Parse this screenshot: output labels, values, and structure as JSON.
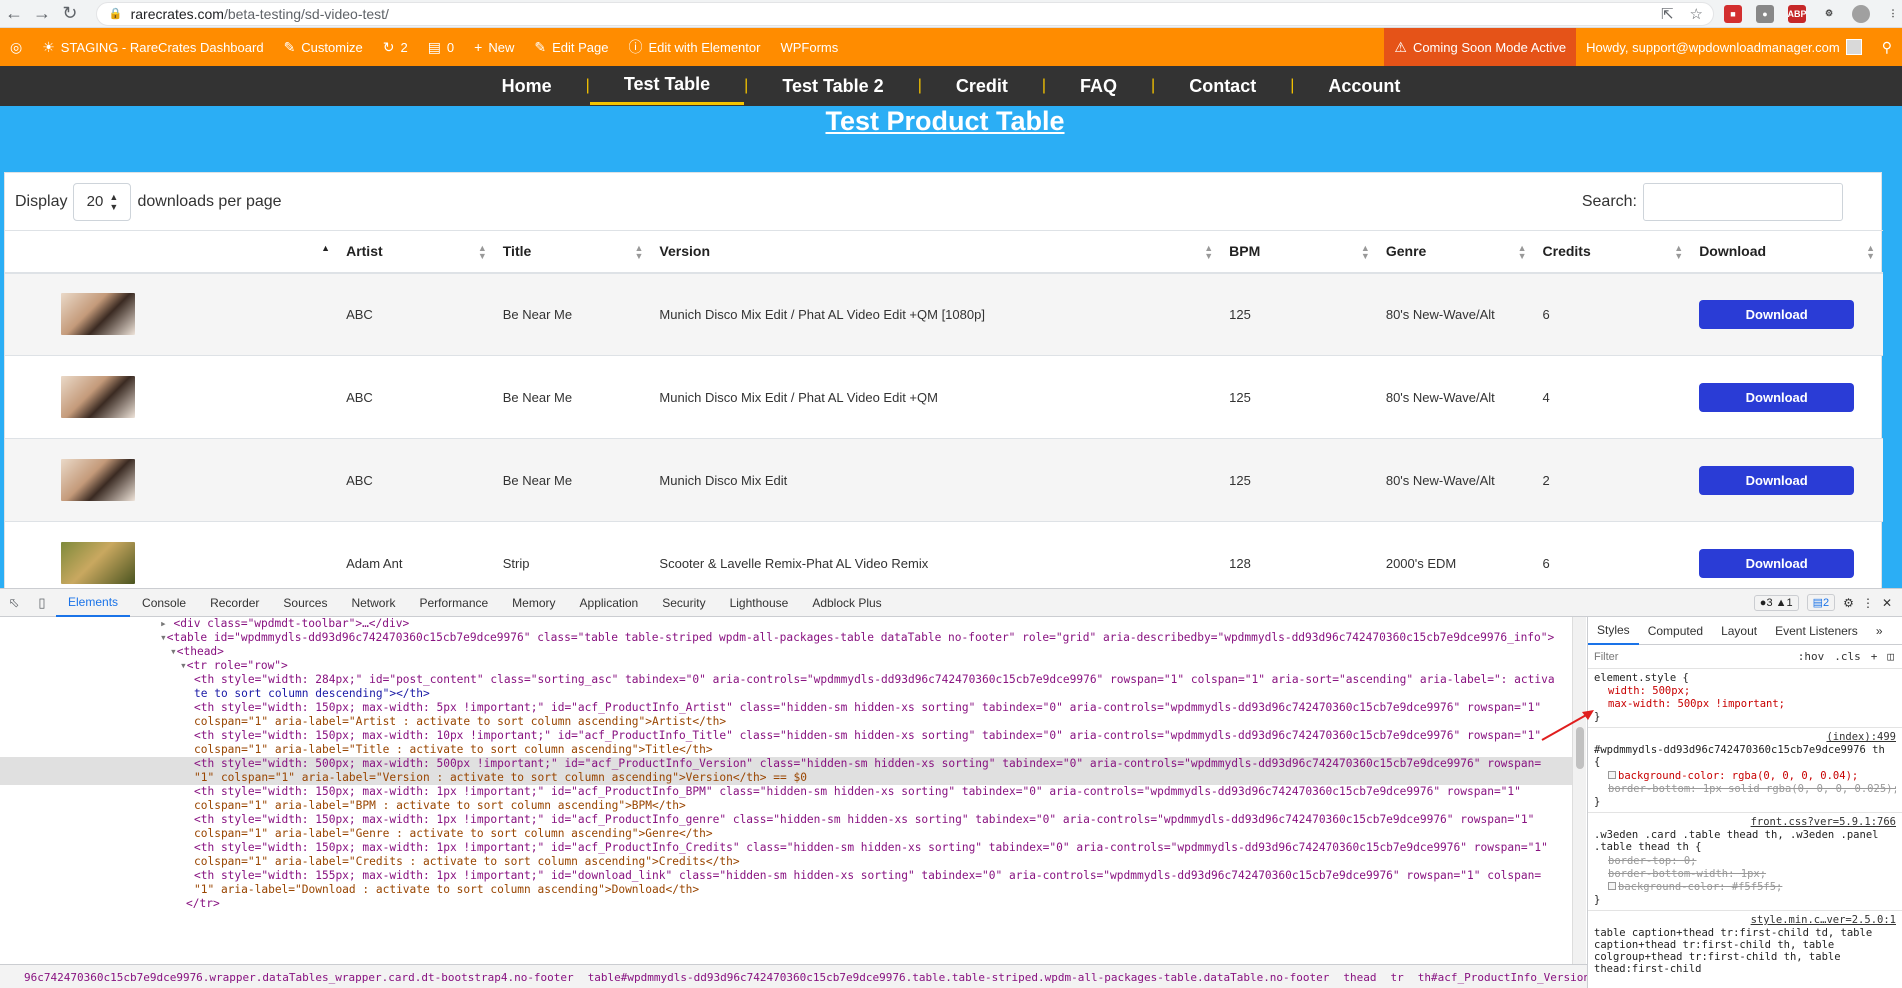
{
  "browser": {
    "url_host": "rarecrates.com",
    "url_path": "/beta-testing/sd-video-test/"
  },
  "admin_bar": {
    "site": "STAGING - RareCrates Dashboard",
    "customize": "Customize",
    "updates": "2",
    "comments": "0",
    "new": "New",
    "edit_page": "Edit Page",
    "elementor": "Edit with Elementor",
    "wpforms": "WPForms",
    "coming_soon": "Coming Soon Mode Active",
    "howdy": "Howdy, support@wpdownloadmanager.com"
  },
  "nav": {
    "items": [
      {
        "label": "Home"
      },
      {
        "label": "Test Table"
      },
      {
        "label": "Test Table 2"
      },
      {
        "label": "Credit"
      },
      {
        "label": "FAQ"
      },
      {
        "label": "Contact"
      },
      {
        "label": "Account"
      }
    ],
    "active": "Test Table"
  },
  "page": {
    "title": "Test Product Table",
    "display_label": "Display",
    "per_page_value": "20",
    "per_page_suffix": "downloads per page",
    "search_label": "Search:"
  },
  "table": {
    "columns": [
      "",
      "Artist",
      "Title",
      "Version",
      "BPM",
      "Genre",
      "Credits",
      "Download"
    ],
    "rows": [
      {
        "artist": "ABC",
        "title": "Be Near Me",
        "version": "Munich Disco Mix Edit / Phat AL Video Edit +QM [1080p]",
        "bpm": "125",
        "genre": "80's New-Wave/Alt",
        "credits": "6",
        "download": "Download"
      },
      {
        "artist": "ABC",
        "title": "Be Near Me",
        "version": "Munich Disco Mix Edit / Phat AL Video Edit +QM",
        "bpm": "125",
        "genre": "80's New-Wave/Alt",
        "credits": "4",
        "download": "Download"
      },
      {
        "artist": "ABC",
        "title": "Be Near Me",
        "version": "Munich Disco Mix Edit",
        "bpm": "125",
        "genre": "80's New-Wave/Alt",
        "credits": "2",
        "download": "Download"
      },
      {
        "artist": "Adam Ant",
        "title": "Strip",
        "version": "Scooter & Lavelle Remix-Phat AL Video Remix",
        "bpm": "128",
        "genre": "2000's EDM",
        "credits": "6",
        "download": "Download"
      }
    ]
  },
  "devtools": {
    "tabs": [
      "Elements",
      "Console",
      "Recorder",
      "Sources",
      "Network",
      "Performance",
      "Memory",
      "Application",
      "Security",
      "Lighthouse",
      "Adblock Plus"
    ],
    "active_tab": "Elements",
    "issues": "3",
    "warnings": "1",
    "messages": "2",
    "code_lines": [
      "<div class=\"wpdmdt-toolbar\">…</div>",
      "<table id=\"wpdmmydls-dd93d96c742470360c15cb7e9dce9976\" class=\"table table-striped wpdm-all-packages-table dataTable no-footer\" role=\"grid\" aria-describedby=\"wpdmmydls-dd93d96c742470360c15cb7e9dce9976_info\">",
      "<thead>",
      "<tr role=\"row\">",
      "<th style=\"width: 284px;\" id=\"post_content\" class=\"sorting_asc\" tabindex=\"0\" aria-controls=\"wpdmmydls-dd93d96c742470360c15cb7e9dce9976\" rowspan=\"1\" colspan=\"1\" aria-sort=\"ascending\" aria-label=\": activa",
      "te to sort column descending\"></th>",
      "<th style=\"width: 150px; max-width: 5px !important;\" id=\"acf_ProductInfo_Artist\" class=\"hidden-sm hidden-xs sorting\" tabindex=\"0\" aria-controls=\"wpdmmydls-dd93d96c742470360c15cb7e9dce9976\" rowspan=\"1\"",
      "colspan=\"1\" aria-label=\"Artist : activate to sort column ascending\">Artist</th>",
      "<th style=\"width: 150px; max-width: 10px !important;\" id=\"acf_ProductInfo_Title\" class=\"hidden-sm hidden-xs sorting\" tabindex=\"0\" aria-controls=\"wpdmmydls-dd93d96c742470360c15cb7e9dce9976\" rowspan=\"1\"",
      "colspan=\"1\" aria-label=\"Title : activate to sort column ascending\">Title</th>",
      "<th style=\"width: 500px; max-width: 500px !important;\" id=\"acf_ProductInfo_Version\" class=\"hidden-sm hidden-xs sorting\" tabindex=\"0\" aria-controls=\"wpdmmydls-dd93d96c742470360c15cb7e9dce9976\" rowspan=",
      "\"1\" colspan=\"1\" aria-label=\"Version : activate to sort column ascending\">Version</th> == $0",
      "<th style=\"width: 150px; max-width: 1px !important;\" id=\"acf_ProductInfo_BPM\" class=\"hidden-sm hidden-xs sorting\" tabindex=\"0\" aria-controls=\"wpdmmydls-dd93d96c742470360c15cb7e9dce9976\" rowspan=\"1\"",
      "colspan=\"1\" aria-label=\"BPM : activate to sort column ascending\">BPM</th>",
      "<th style=\"width: 150px; max-width: 1px !important;\" id=\"acf_ProductInfo_genre\" class=\"hidden-sm hidden-xs sorting\" tabindex=\"0\" aria-controls=\"wpdmmydls-dd93d96c742470360c15cb7e9dce9976\" rowspan=\"1\"",
      "colspan=\"1\" aria-label=\"Genre : activate to sort column ascending\">Genre</th>",
      "<th style=\"width: 150px; max-width: 1px !important;\" id=\"acf_ProductInfo_Credits\" class=\"hidden-sm hidden-xs sorting\" tabindex=\"0\" aria-controls=\"wpdmmydls-dd93d96c742470360c15cb7e9dce9976\" rowspan=\"1\"",
      "colspan=\"1\" aria-label=\"Credits : activate to sort column ascending\">Credits</th>",
      "<th style=\"width: 155px; max-width: 1px !important;\" id=\"download_link\" class=\"hidden-sm hidden-xs sorting\" tabindex=\"0\" aria-controls=\"wpdmmydls-dd93d96c742470360c15cb7e9dce9976\" rowspan=\"1\" colspan=",
      "\"1\" aria-label=\"Download : activate to sort column ascending\">Download</th>",
      "</tr>"
    ],
    "styles_tabs": [
      "Styles",
      "Computed",
      "Layout",
      "Event Listeners"
    ],
    "filter_placeholder": "Filter",
    "hov": ":hov",
    "cls": ".cls",
    "rules": [
      {
        "selector": "element.style {",
        "decls": [
          "width: 500px;",
          "max-width: 500px !important;"
        ],
        "source": ""
      },
      {
        "selector": "#wpdmmydls-dd93d96c742470360c15cb7e9dce9976 th {",
        "decls": [
          "background-color: rgba(0, 0, 0, 0.04);",
          "border-bottom: 1px solid rgba(0, 0, 0, 0.025);"
        ],
        "source": "(index):499"
      },
      {
        "selector": ".w3eden .card .table thead th, .w3eden .panel .table thead th {",
        "decls": [
          "border-top: 0;",
          "border-bottom-width: 1px;",
          "background-color: #f5f5f5;"
        ],
        "source": "front.css?ver=5.9.1:766"
      },
      {
        "selector": "table caption+thead tr:first-child td, table caption+thead tr:first-child th, table colgroup+thead tr:first-child th, table thead:first-child",
        "decls": [],
        "source": "style.min.c…ver=2.5.0:1"
      }
    ],
    "breadcrumb": [
      "96c742470360c15cb7e9dce9976.wrapper.dataTables_wrapper.card.dt-bootstrap4.no-footer",
      "table#wpdmmydls-dd93d96c742470360c15cb7e9dce9976.table.table-striped.wpdm-all-packages-table.dataTable.no-footer",
      "thead",
      "tr",
      "th#acf_ProductInfo_Version.hidden-sm.hidden-xs.sorting"
    ]
  },
  "colors": {
    "admin_bar": "#ff8c00",
    "nav_bg": "#333333",
    "page_bg": "#2baef5",
    "download_button": "#2a3cd6",
    "accent_underline": "#f5c400"
  }
}
